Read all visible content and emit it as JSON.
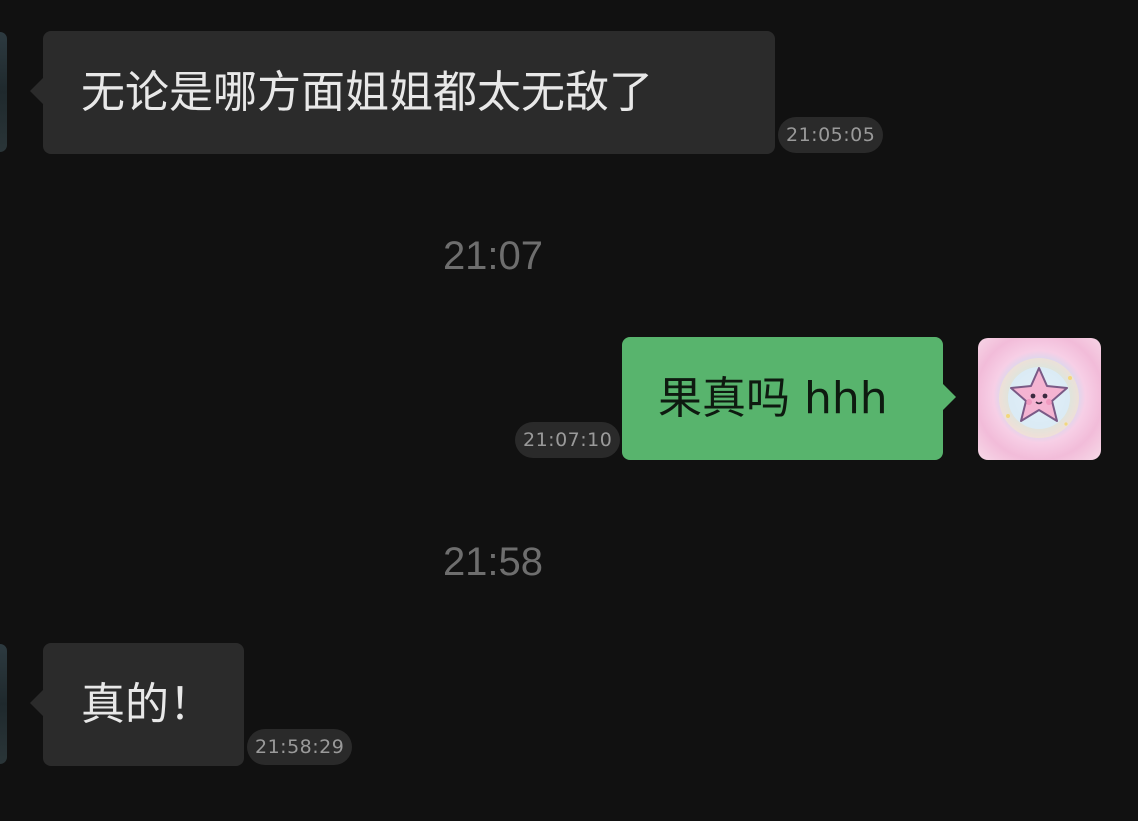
{
  "messages": [
    {
      "side": "left",
      "text": "无论是哪方面姐姐都太无敌了",
      "time": "21:05:05"
    },
    {
      "side": "right",
      "text": "果真吗 hhh",
      "time": "21:07:10"
    },
    {
      "side": "left",
      "text": "真的！",
      "time": "21:58:29"
    }
  ],
  "dividers": [
    "21:07",
    "21:58"
  ],
  "avatar": {
    "icon": "pink-star-sticker-icon"
  },
  "colors": {
    "background": "#111111",
    "incoming_bubble": "#2b2b2b",
    "outgoing_bubble": "#58b46d"
  }
}
